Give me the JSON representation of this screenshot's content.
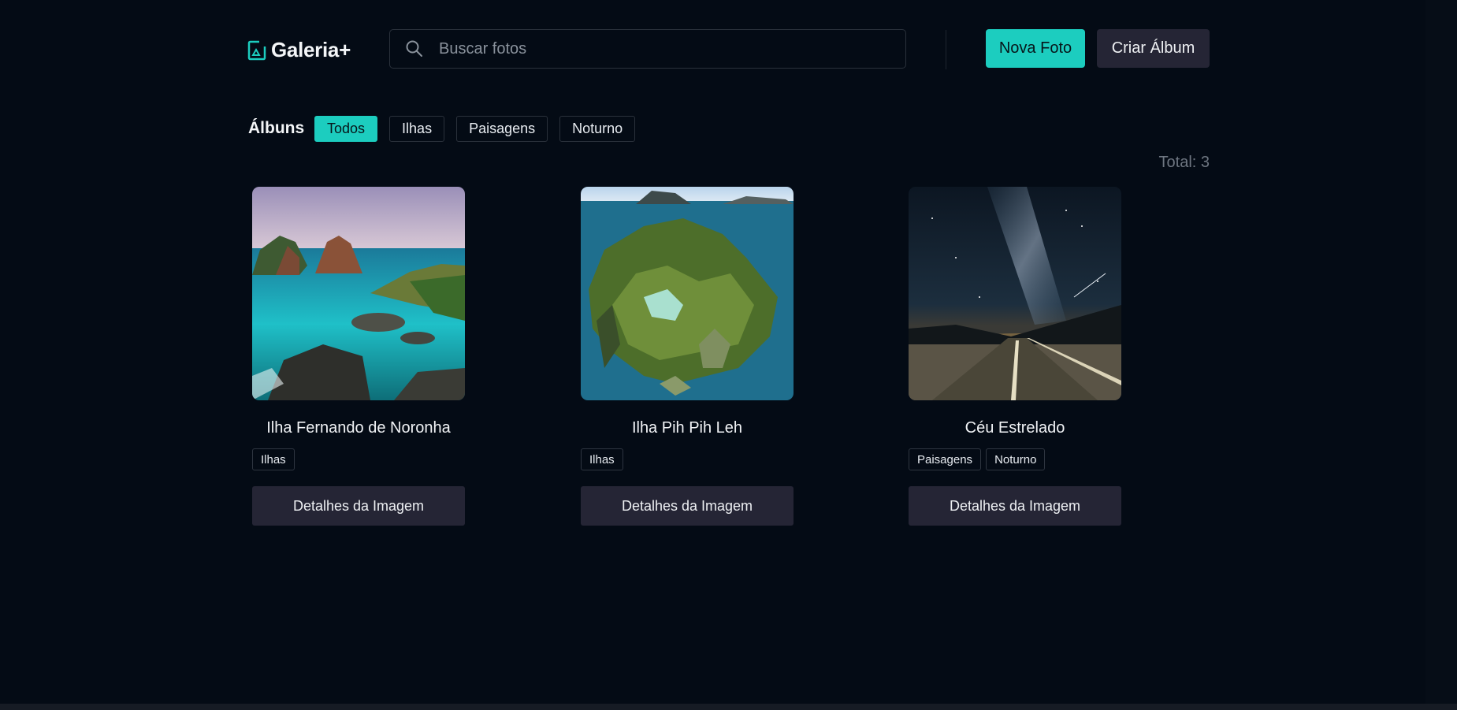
{
  "header": {
    "logo_text": "Galeria+",
    "search_placeholder": "Buscar fotos",
    "new_photo_label": "Nova Foto",
    "create_album_label": "Criar Álbum"
  },
  "albums": {
    "label": "Álbuns",
    "filters": [
      "Todos",
      "Ilhas",
      "Paisagens",
      "Noturno"
    ],
    "active_filter": "Todos"
  },
  "total_text": "Total: 3",
  "cards": [
    {
      "title": "Ilha Fernando de Noronha",
      "tags": [
        "Ilhas"
      ],
      "button_label": "Detalhes da Imagem",
      "image": "tropical island sea rocks"
    },
    {
      "title": "Ilha Pih Pih Leh",
      "tags": [
        "Ilhas"
      ],
      "button_label": "Detalhes da Imagem",
      "image": "aerial green island lagoon"
    },
    {
      "title": "Céu Estrelado",
      "tags": [
        "Paisagens",
        "Noturno"
      ],
      "button_label": "Detalhes da Imagem",
      "image": "milky way over road"
    }
  ],
  "colors": {
    "background": "#040b15",
    "accent": "#1ccdbf",
    "secondary_button": "#252535"
  }
}
